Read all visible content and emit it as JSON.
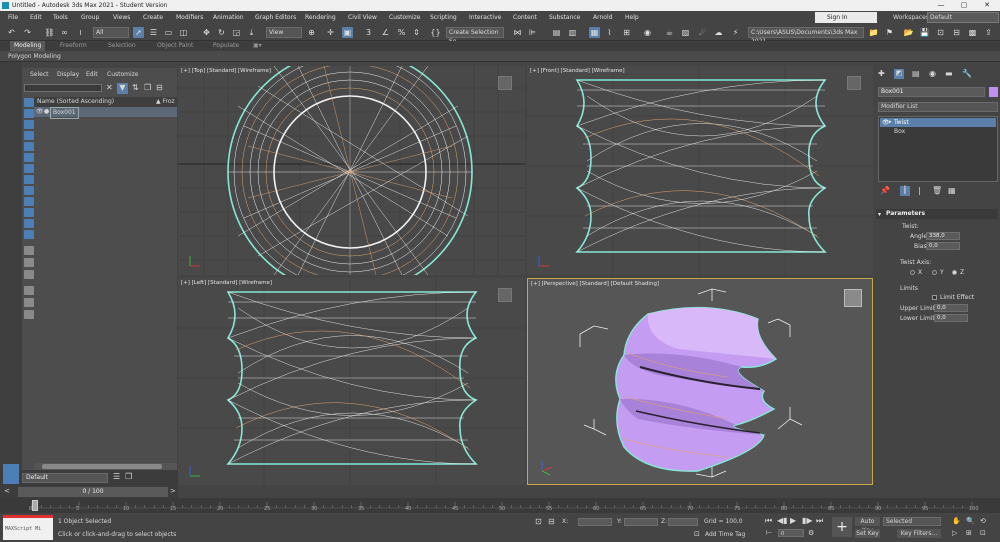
{
  "window": {
    "title": "Untitled - Autodesk 3ds Max 2021 - Student Version",
    "controls": [
      "—",
      "▢",
      "✕"
    ]
  },
  "menubar": {
    "items": [
      "File",
      "Edit",
      "Tools",
      "Group",
      "Views",
      "Create",
      "Modifiers",
      "Animation",
      "Graph Editors",
      "Rendering",
      "Civil View",
      "Customize",
      "Scripting",
      "Interactive",
      "Content",
      "Substance",
      "Arnold",
      "Help"
    ],
    "signin": "Sign In",
    "workspaces_label": "Workspaces:",
    "workspace_value": "Default"
  },
  "toolbar": {
    "filter_value": "All",
    "refcoord_value": "View",
    "selection_set": "Create Selection Se",
    "path": "C:\\Users\\ASUS\\Documents\\3ds Max 2021"
  },
  "ribbon": {
    "tabs": [
      "Modeling",
      "Freeform",
      "Selection",
      "Object Paint",
      "Populate"
    ],
    "active": 0,
    "sub": "Polygon Modeling"
  },
  "scene_explorer": {
    "tabs": [
      "Select",
      "Display",
      "Edit",
      "Customize"
    ],
    "column_header": "Name (Sorted Ascending)",
    "column_frozen": "▲ Froz",
    "items": [
      {
        "name": "Box001"
      }
    ]
  },
  "layer": {
    "value": "Default"
  },
  "frames": {
    "counter": "0 / 100"
  },
  "viewports": {
    "top": "[+] [Top] [Standard] [Wireframe]",
    "front": "[+] [Front] [Standard] [Wireframe]",
    "left": "[+] [Left] [Standard] [Wireframe]",
    "perspective": "[+] [Perspective] [Standard] [Default Shading]"
  },
  "command_panel": {
    "object_name": "Box001",
    "object_color": "#c28ff0",
    "modifier_list": "Modifier List",
    "stack": [
      "Twist",
      "Box"
    ],
    "parameters": {
      "title": "Parameters",
      "twist_label": "Twist:",
      "angle_label": "Angle:",
      "angle_value": "338,0",
      "bias_label": "Bias:",
      "bias_value": "0,0",
      "axis_label": "Twist Axis:",
      "axes": [
        "X",
        "Y",
        "Z"
      ],
      "axis_selected": "Z",
      "limits_label": "Limits",
      "limit_effect": "Limit Effect",
      "upper_label": "Upper Limit:",
      "upper_value": "0,0",
      "lower_label": "Lower Limit:",
      "lower_value": "0,0"
    }
  },
  "timeline": {
    "ticks": [
      "0",
      "5",
      "10",
      "15",
      "20",
      "25",
      "30",
      "35",
      "40",
      "45",
      "50",
      "55",
      "60",
      "65",
      "70",
      "75",
      "80",
      "85",
      "90",
      "95",
      "100"
    ]
  },
  "statusbar": {
    "maxscript": "MAXScript Mi",
    "selected": "1 Object Selected",
    "prompt": "Click or click-and-drag to select objects",
    "x_label": "X:",
    "y_label": "Y:",
    "z_label": "Z:",
    "grid": "Grid = 100,0",
    "add_time_tag": "Add Time Tag",
    "auto_key": "Auto Key",
    "set_key": "Set Key",
    "selected_dd": "Selected",
    "key_filters": "Key Filters...",
    "frame_value": "0"
  },
  "colors": {
    "accent": "#5a7fa8",
    "wire_white": "#f2f2f2",
    "wire_orange": "#e0a36a",
    "outline_cyan": "#86e8d4",
    "object_purple": "#c49cf2"
  }
}
